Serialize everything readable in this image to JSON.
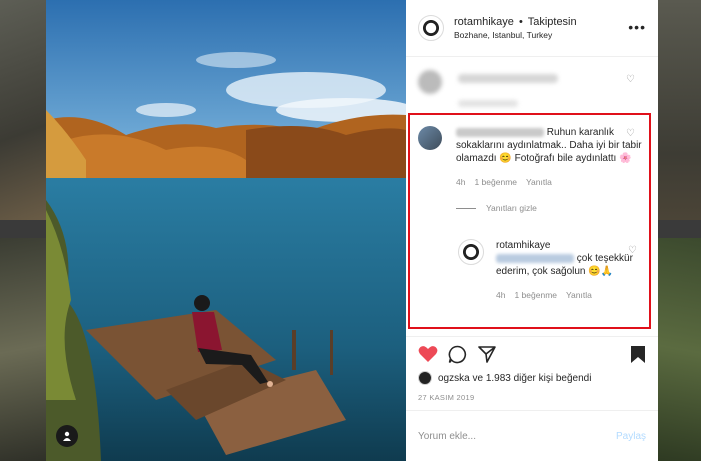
{
  "post": {
    "username": "rotamhikaye",
    "separator": "•",
    "follow_status": "Takiptesin",
    "location": "Bozhane, Istanbul, Turkey",
    "more_icon": "more-horizontal-icon"
  },
  "comments": {
    "main": {
      "text_line1": "Ruhun",
      "text_rest": "karanlık sokaklarını aydınlatmak.. Daha iyi bir tabir olamazdı 😊 Fotoğrafı bile aydınlattı 🌸",
      "time": "4h",
      "likes": "1 beğenme",
      "reply_label": "Yanıtla"
    },
    "hide_replies": "Yanıtları gizle",
    "reply": {
      "username": "rotamhikaye",
      "text": "çok teşekkür ederim, çok sağolun 😊🙏",
      "time": "4h",
      "likes": "1 beğenme",
      "reply_label": "Yanıtla"
    }
  },
  "likes": {
    "text_user": "ogzska",
    "text_and": " ve ",
    "text_count": "1.983 diğer kişi",
    "text_suffix": " beğendi"
  },
  "date": "27 KASIM 2019",
  "add_comment": {
    "placeholder": "Yorum ekle...",
    "post_label": "Paylaş"
  },
  "colors": {
    "heart": "#ed4956",
    "highlight": "#e0101a",
    "post_button": "#b3dbff"
  }
}
